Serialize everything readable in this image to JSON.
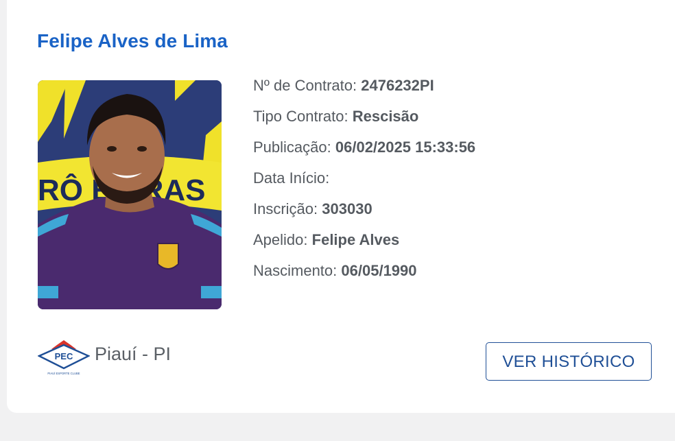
{
  "player": {
    "name": "Felipe Alves de Lima"
  },
  "details": {
    "contract_label": "Nº de Contrato:",
    "contract_value": "2476232PI",
    "type_label": "Tipo Contrato:",
    "type_value": "Rescisão",
    "publication_label": "Publicação:",
    "publication_value": "06/02/2025 15:33:56",
    "start_label": "Data Início:",
    "start_value": "",
    "registration_label": "Inscrição:",
    "registration_value": "303030",
    "nickname_label": "Apelido:",
    "nickname_value": "Felipe Alves",
    "birth_label": "Nascimento:",
    "birth_value": "06/05/1990"
  },
  "footer": {
    "logo_text": "PEC",
    "logo_subtext": "PIAUÍ ESPORTE CLUBE",
    "state": "Piauí - PI",
    "history_button": "VER HISTÓRICO"
  },
  "photo": {
    "banner_text": "RÔ E BRAS"
  },
  "colors": {
    "name_blue": "#1a63c6",
    "button_blue": "#1f4f96",
    "text_gray": "#555a60",
    "page_bg": "#f1f1f2",
    "card_bg": "#ffffff"
  }
}
